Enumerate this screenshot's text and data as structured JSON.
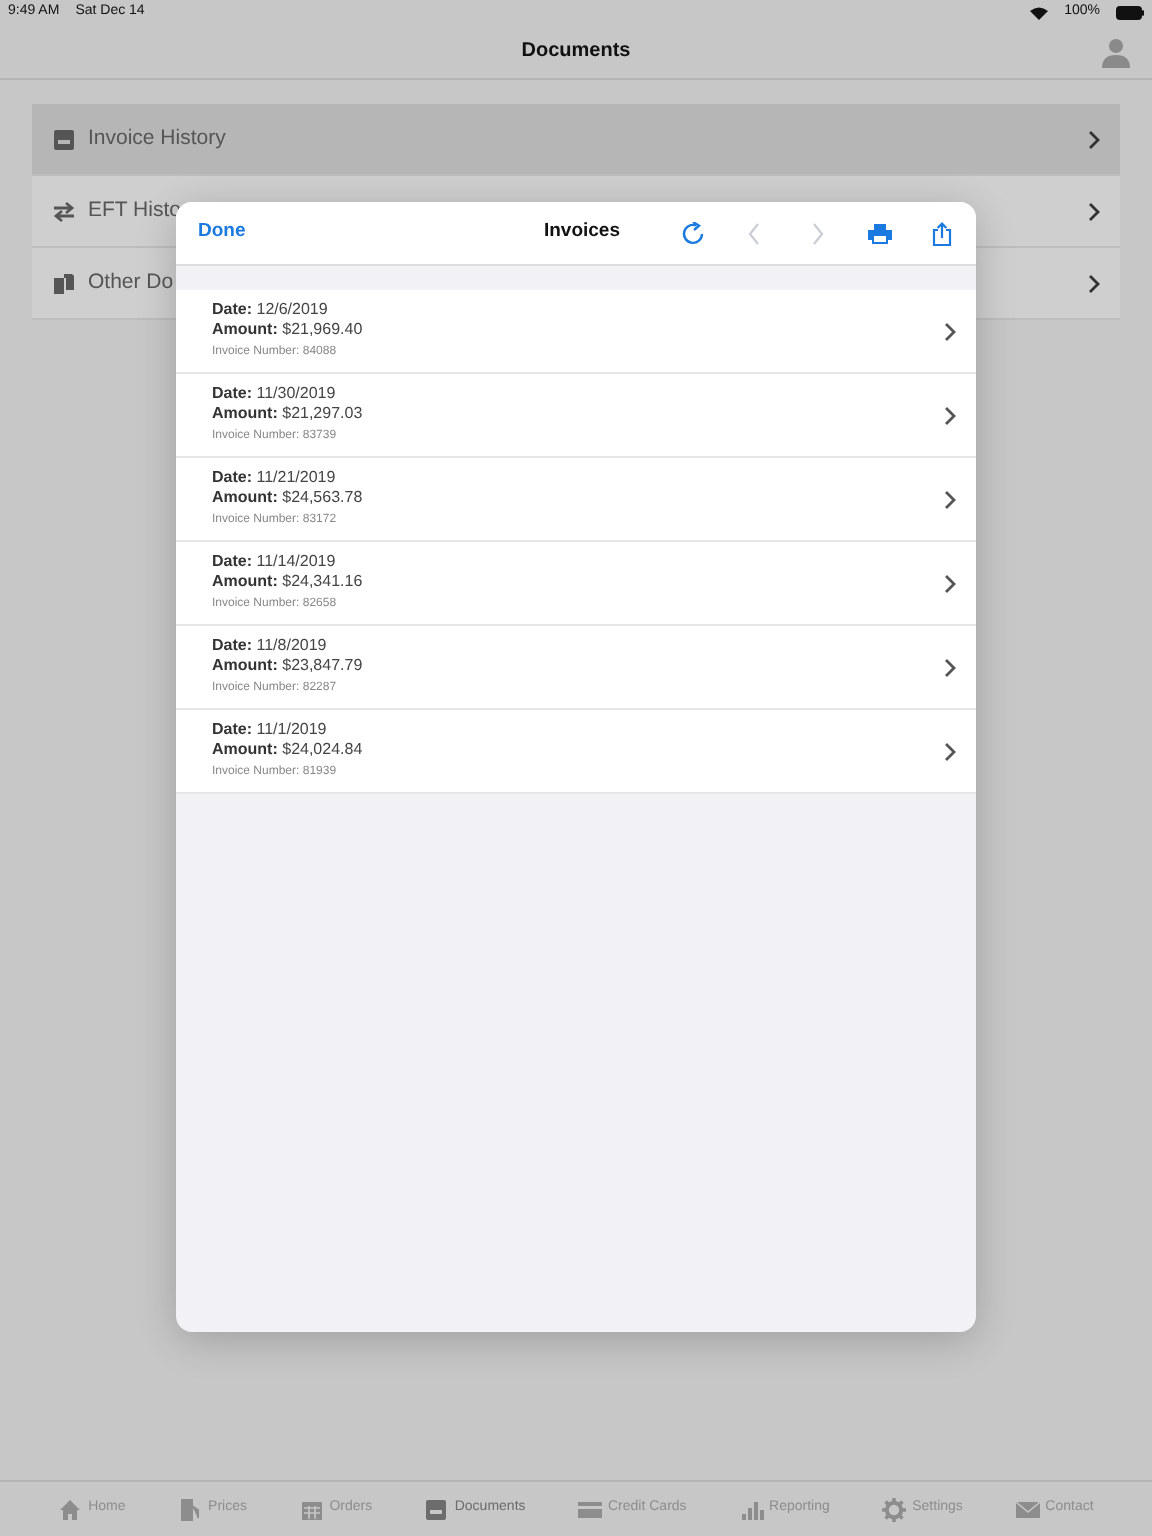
{
  "status_bar": {
    "time": "9:49 AM",
    "date": "Sat Dec 14",
    "battery": "100%"
  },
  "nav_bar": {
    "title": "Documents"
  },
  "menu": [
    {
      "label": "Invoice History",
      "kind": "inbox",
      "selected": true
    },
    {
      "label": "EFT Histo",
      "kind": "transfer",
      "selected": false
    },
    {
      "label": "Other Do",
      "kind": "files",
      "selected": false
    }
  ],
  "modal": {
    "done": "Done",
    "title": "Invoices",
    "toolbar": [
      {
        "kind": "refresh",
        "disabled": false
      },
      {
        "kind": "back",
        "disabled": true
      },
      {
        "kind": "forward",
        "disabled": true
      },
      {
        "kind": "print",
        "disabled": false
      },
      {
        "kind": "share",
        "disabled": false
      }
    ],
    "invoices": [
      {
        "date": "**Date:** 12/6/2019",
        "amount": "**Amount:** $21,969.40",
        "number": "Invoice Number: 84088"
      },
      {
        "date": "**Date:** 11/30/2019",
        "amount": "**Amount:** $21,297.03",
        "number": "Invoice Number: 83739"
      },
      {
        "date": "**Date:** 11/21/2019",
        "amount": "**Amount:** $24,563.78",
        "number": "Invoice Number: 83172"
      },
      {
        "date": "**Date:** 11/14/2019",
        "amount": "**Amount:** $24,341.16",
        "number": "Invoice Number: 82658"
      },
      {
        "date": "**Date:** 11/8/2019",
        "amount": "**Amount:** $23,847.79",
        "number": "Invoice Number: 82287"
      },
      {
        "date": "**Date:** 11/1/2019",
        "amount": "**Amount:** $24,024.84",
        "number": "Invoice Number: 81939"
      }
    ]
  },
  "tab_bar": [
    {
      "label": "Home",
      "kind": "home",
      "selected": false
    },
    {
      "label": "Prices",
      "kind": "pump",
      "selected": false
    },
    {
      "label": "Orders",
      "kind": "calendar",
      "selected": false
    },
    {
      "label": "Documents",
      "kind": "inbox",
      "selected": true
    },
    {
      "label": "Credit Cards",
      "kind": "card",
      "selected": false
    },
    {
      "label": "Reporting",
      "kind": "chart",
      "selected": false
    },
    {
      "label": "Settings",
      "kind": "gear",
      "selected": false
    },
    {
      "label": "Contact",
      "kind": "envelope",
      "selected": false
    }
  ]
}
